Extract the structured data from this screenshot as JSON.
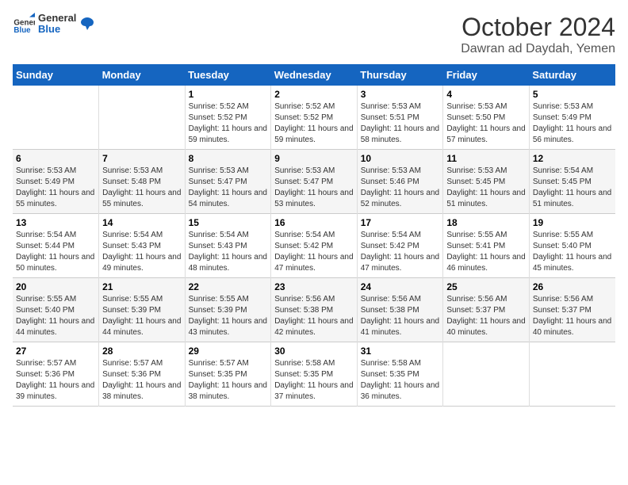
{
  "logo": {
    "text_general": "General",
    "text_blue": "Blue"
  },
  "title": "October 2024",
  "subtitle": "Dawran ad Daydah, Yemen",
  "weekdays": [
    "Sunday",
    "Monday",
    "Tuesday",
    "Wednesday",
    "Thursday",
    "Friday",
    "Saturday"
  ],
  "weeks": [
    [
      null,
      null,
      {
        "day": "1",
        "sunrise": "Sunrise: 5:52 AM",
        "sunset": "Sunset: 5:52 PM",
        "daylight": "Daylight: 11 hours and 59 minutes."
      },
      {
        "day": "2",
        "sunrise": "Sunrise: 5:52 AM",
        "sunset": "Sunset: 5:52 PM",
        "daylight": "Daylight: 11 hours and 59 minutes."
      },
      {
        "day": "3",
        "sunrise": "Sunrise: 5:53 AM",
        "sunset": "Sunset: 5:51 PM",
        "daylight": "Daylight: 11 hours and 58 minutes."
      },
      {
        "day": "4",
        "sunrise": "Sunrise: 5:53 AM",
        "sunset": "Sunset: 5:50 PM",
        "daylight": "Daylight: 11 hours and 57 minutes."
      },
      {
        "day": "5",
        "sunrise": "Sunrise: 5:53 AM",
        "sunset": "Sunset: 5:49 PM",
        "daylight": "Daylight: 11 hours and 56 minutes."
      }
    ],
    [
      {
        "day": "6",
        "sunrise": "Sunrise: 5:53 AM",
        "sunset": "Sunset: 5:49 PM",
        "daylight": "Daylight: 11 hours and 55 minutes."
      },
      {
        "day": "7",
        "sunrise": "Sunrise: 5:53 AM",
        "sunset": "Sunset: 5:48 PM",
        "daylight": "Daylight: 11 hours and 55 minutes."
      },
      {
        "day": "8",
        "sunrise": "Sunrise: 5:53 AM",
        "sunset": "Sunset: 5:47 PM",
        "daylight": "Daylight: 11 hours and 54 minutes."
      },
      {
        "day": "9",
        "sunrise": "Sunrise: 5:53 AM",
        "sunset": "Sunset: 5:47 PM",
        "daylight": "Daylight: 11 hours and 53 minutes."
      },
      {
        "day": "10",
        "sunrise": "Sunrise: 5:53 AM",
        "sunset": "Sunset: 5:46 PM",
        "daylight": "Daylight: 11 hours and 52 minutes."
      },
      {
        "day": "11",
        "sunrise": "Sunrise: 5:53 AM",
        "sunset": "Sunset: 5:45 PM",
        "daylight": "Daylight: 11 hours and 51 minutes."
      },
      {
        "day": "12",
        "sunrise": "Sunrise: 5:54 AM",
        "sunset": "Sunset: 5:45 PM",
        "daylight": "Daylight: 11 hours and 51 minutes."
      }
    ],
    [
      {
        "day": "13",
        "sunrise": "Sunrise: 5:54 AM",
        "sunset": "Sunset: 5:44 PM",
        "daylight": "Daylight: 11 hours and 50 minutes."
      },
      {
        "day": "14",
        "sunrise": "Sunrise: 5:54 AM",
        "sunset": "Sunset: 5:43 PM",
        "daylight": "Daylight: 11 hours and 49 minutes."
      },
      {
        "day": "15",
        "sunrise": "Sunrise: 5:54 AM",
        "sunset": "Sunset: 5:43 PM",
        "daylight": "Daylight: 11 hours and 48 minutes."
      },
      {
        "day": "16",
        "sunrise": "Sunrise: 5:54 AM",
        "sunset": "Sunset: 5:42 PM",
        "daylight": "Daylight: 11 hours and 47 minutes."
      },
      {
        "day": "17",
        "sunrise": "Sunrise: 5:54 AM",
        "sunset": "Sunset: 5:42 PM",
        "daylight": "Daylight: 11 hours and 47 minutes."
      },
      {
        "day": "18",
        "sunrise": "Sunrise: 5:55 AM",
        "sunset": "Sunset: 5:41 PM",
        "daylight": "Daylight: 11 hours and 46 minutes."
      },
      {
        "day": "19",
        "sunrise": "Sunrise: 5:55 AM",
        "sunset": "Sunset: 5:40 PM",
        "daylight": "Daylight: 11 hours and 45 minutes."
      }
    ],
    [
      {
        "day": "20",
        "sunrise": "Sunrise: 5:55 AM",
        "sunset": "Sunset: 5:40 PM",
        "daylight": "Daylight: 11 hours and 44 minutes."
      },
      {
        "day": "21",
        "sunrise": "Sunrise: 5:55 AM",
        "sunset": "Sunset: 5:39 PM",
        "daylight": "Daylight: 11 hours and 44 minutes."
      },
      {
        "day": "22",
        "sunrise": "Sunrise: 5:55 AM",
        "sunset": "Sunset: 5:39 PM",
        "daylight": "Daylight: 11 hours and 43 minutes."
      },
      {
        "day": "23",
        "sunrise": "Sunrise: 5:56 AM",
        "sunset": "Sunset: 5:38 PM",
        "daylight": "Daylight: 11 hours and 42 minutes."
      },
      {
        "day": "24",
        "sunrise": "Sunrise: 5:56 AM",
        "sunset": "Sunset: 5:38 PM",
        "daylight": "Daylight: 11 hours and 41 minutes."
      },
      {
        "day": "25",
        "sunrise": "Sunrise: 5:56 AM",
        "sunset": "Sunset: 5:37 PM",
        "daylight": "Daylight: 11 hours and 40 minutes."
      },
      {
        "day": "26",
        "sunrise": "Sunrise: 5:56 AM",
        "sunset": "Sunset: 5:37 PM",
        "daylight": "Daylight: 11 hours and 40 minutes."
      }
    ],
    [
      {
        "day": "27",
        "sunrise": "Sunrise: 5:57 AM",
        "sunset": "Sunset: 5:36 PM",
        "daylight": "Daylight: 11 hours and 39 minutes."
      },
      {
        "day": "28",
        "sunrise": "Sunrise: 5:57 AM",
        "sunset": "Sunset: 5:36 PM",
        "daylight": "Daylight: 11 hours and 38 minutes."
      },
      {
        "day": "29",
        "sunrise": "Sunrise: 5:57 AM",
        "sunset": "Sunset: 5:35 PM",
        "daylight": "Daylight: 11 hours and 38 minutes."
      },
      {
        "day": "30",
        "sunrise": "Sunrise: 5:58 AM",
        "sunset": "Sunset: 5:35 PM",
        "daylight": "Daylight: 11 hours and 37 minutes."
      },
      {
        "day": "31",
        "sunrise": "Sunrise: 5:58 AM",
        "sunset": "Sunset: 5:35 PM",
        "daylight": "Daylight: 11 hours and 36 minutes."
      },
      null,
      null
    ]
  ]
}
